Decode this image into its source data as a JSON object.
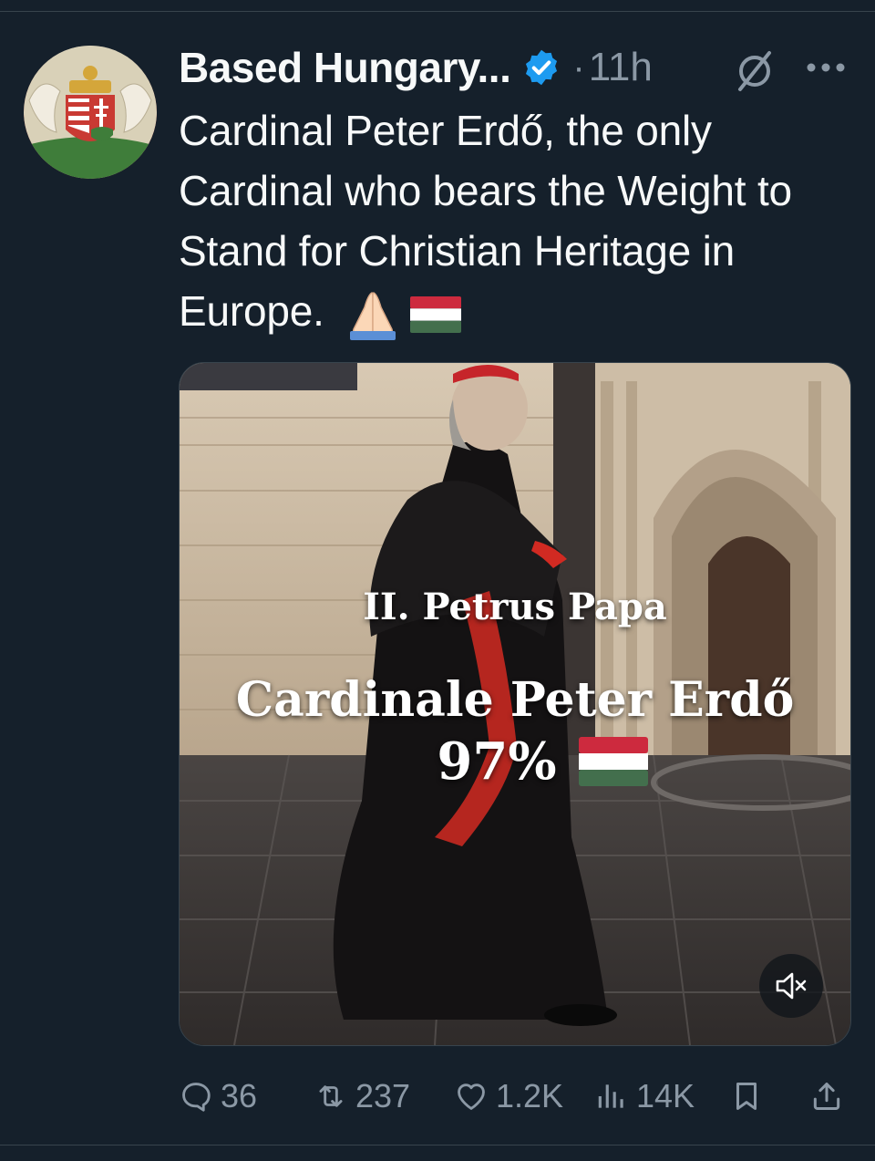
{
  "tweet": {
    "display_name": "Based Hungary...",
    "separator": "·",
    "time": "11h",
    "text": "Cardinal Peter Erdő, the only Cardinal who bears the Weight to Stand for Christian Heritage in Europe.",
    "emojis": [
      "folded-hands",
      "hungary-flag"
    ]
  },
  "media": {
    "overlay_line1": "II. Petrus Papa",
    "overlay_line2": "Cardinale Peter Erdő",
    "overlay_line3": "97%"
  },
  "actions": {
    "replies": "36",
    "reposts": "237",
    "likes": "1.2K",
    "views": "14K"
  },
  "colors": {
    "background": "#15202b",
    "text": "#f7f9f9",
    "muted": "#8b98a5",
    "verified": "#1d9bf0",
    "flag_red": "#cd2a3e",
    "flag_green": "#436f4d"
  }
}
